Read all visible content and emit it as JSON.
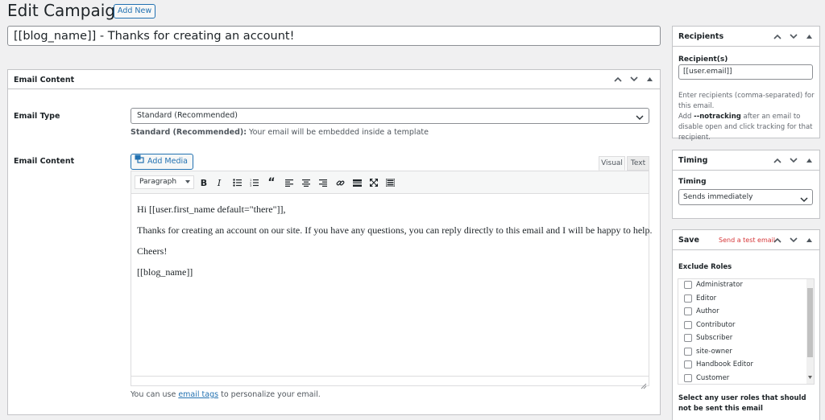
{
  "header": {
    "title": "Edit Campaign",
    "add_new_label": "Add New"
  },
  "campaign_title": "[[blog_name]] - Thanks for creating an account!",
  "email_content_box": {
    "title": "Email Content",
    "email_type_label": "Email Type",
    "email_type_value": "Standard (Recommended)",
    "email_type_help_bold": "Standard (Recommended):",
    "email_type_help_text": " Your email will be embedded inside a template",
    "email_content_label": "Email Content",
    "add_media_label": "Add Media",
    "tab_visual": "Visual",
    "tab_text": "Text",
    "format_select": "Paragraph",
    "body": [
      "Hi [[user.first_name default=\"there\"]],",
      "Thanks for creating an account on our site. If you have any questions, you can reply directly to this email and I will be happy to help.",
      "Cheers!",
      "[[blog_name]]"
    ],
    "help_prefix": "You can use ",
    "help_link": "email tags",
    "help_suffix": " to personalize your email."
  },
  "recipients_box": {
    "title": "Recipients",
    "label": "Recipient(s)",
    "value": "[[user.email]]",
    "help1": "Enter recipients (comma-separated) for this email.",
    "help2_prefix": "Add ",
    "help2_bold": "--notracking",
    "help2_suffix": " after an email to disable open and click tracking for that recipient."
  },
  "timing_box": {
    "title": "Timing",
    "label": "Timing",
    "value": "Sends immediately"
  },
  "save_box": {
    "title": "Save",
    "send_test_label": "Send a test email",
    "exclude_roles_label": "Exclude Roles",
    "roles": [
      "Administrator",
      "Editor",
      "Author",
      "Contributor",
      "Subscriber",
      "site-owner",
      "Handbook Editor",
      "Customer"
    ],
    "help": "Select any user roles that should not be sent this email"
  }
}
